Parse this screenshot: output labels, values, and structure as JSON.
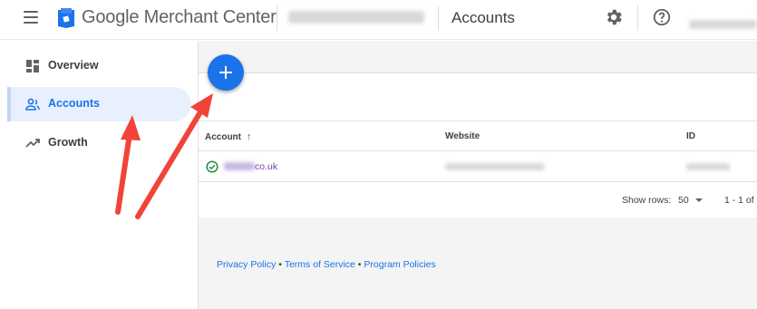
{
  "header": {
    "brand_google": "Google",
    "brand_product": "Merchant Center",
    "page_title": "Accounts"
  },
  "sidebar": {
    "items": [
      {
        "label": "Overview",
        "icon": "dashboard-icon"
      },
      {
        "label": "Accounts",
        "icon": "people-icon",
        "active": true
      },
      {
        "label": "Growth",
        "icon": "trending-up-icon"
      }
    ]
  },
  "table": {
    "columns": [
      "Account",
      "Website",
      "ID"
    ],
    "rows": [
      {
        "account_suffix": "co.uk",
        "status_icon": "check-circle-icon"
      }
    ]
  },
  "pagination": {
    "show_rows_label": "Show rows:",
    "rows_value": "50",
    "range": "1 - 1 of"
  },
  "footer": {
    "privacy": "Privacy Policy",
    "terms": "Terms of Service",
    "program": "Program Policies",
    "separator": " • "
  },
  "colors": {
    "accent": "#1a73e8",
    "active_bg": "#e8f0fe",
    "success": "#1e8e3e",
    "annotation_arrow": "#f04438"
  }
}
